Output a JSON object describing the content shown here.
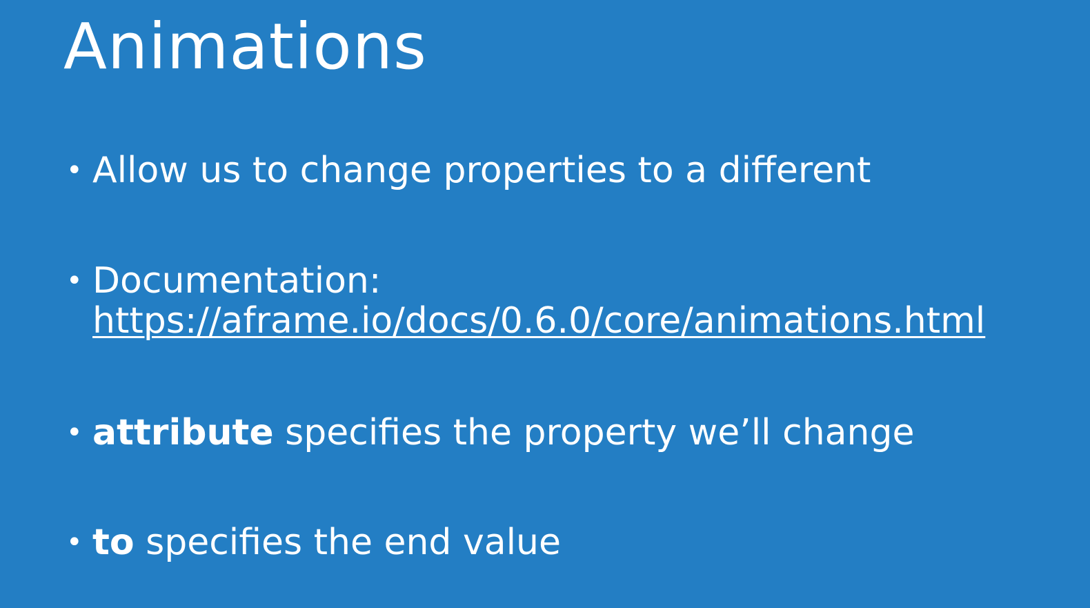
{
  "slide": {
    "background_color": "#237ec4",
    "text_color": "#ffffff",
    "title": "Animations",
    "bullet_glyph": "•",
    "bullets": [
      {
        "text": "Allow us to change properties to a different"
      },
      {
        "label": "Documentation:",
        "link": "https://aframe.io/docs/0.6.0/core/animations.html"
      },
      {
        "strong": "attribute",
        "rest": " specifies the property we’ll change"
      },
      {
        "strong": "to",
        "rest": " specifies the end value"
      }
    ]
  }
}
